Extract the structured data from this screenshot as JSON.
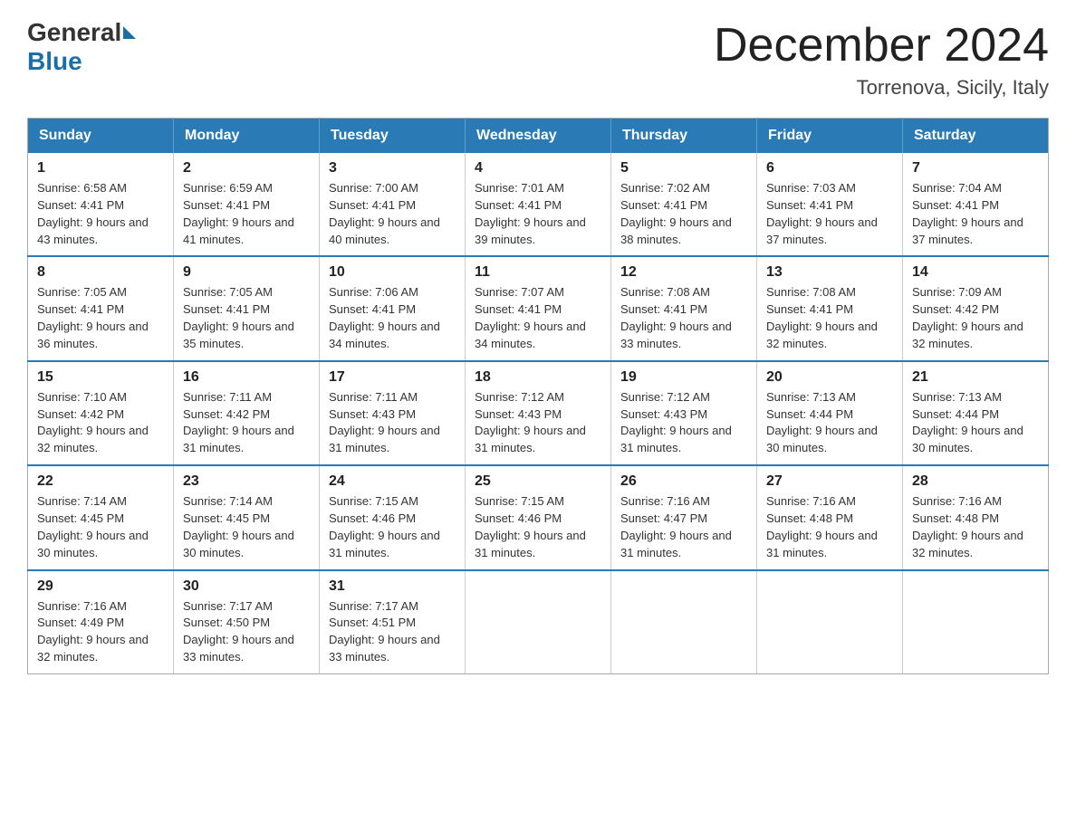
{
  "header": {
    "logo_general": "General",
    "logo_blue": "Blue",
    "month_title": "December 2024",
    "location": "Torrenova, Sicily, Italy"
  },
  "days_of_week": [
    "Sunday",
    "Monday",
    "Tuesday",
    "Wednesday",
    "Thursday",
    "Friday",
    "Saturday"
  ],
  "weeks": [
    [
      {
        "day": "1",
        "sunrise": "6:58 AM",
        "sunset": "4:41 PM",
        "daylight": "9 hours and 43 minutes."
      },
      {
        "day": "2",
        "sunrise": "6:59 AM",
        "sunset": "4:41 PM",
        "daylight": "9 hours and 41 minutes."
      },
      {
        "day": "3",
        "sunrise": "7:00 AM",
        "sunset": "4:41 PM",
        "daylight": "9 hours and 40 minutes."
      },
      {
        "day": "4",
        "sunrise": "7:01 AM",
        "sunset": "4:41 PM",
        "daylight": "9 hours and 39 minutes."
      },
      {
        "day": "5",
        "sunrise": "7:02 AM",
        "sunset": "4:41 PM",
        "daylight": "9 hours and 38 minutes."
      },
      {
        "day": "6",
        "sunrise": "7:03 AM",
        "sunset": "4:41 PM",
        "daylight": "9 hours and 37 minutes."
      },
      {
        "day": "7",
        "sunrise": "7:04 AM",
        "sunset": "4:41 PM",
        "daylight": "9 hours and 37 minutes."
      }
    ],
    [
      {
        "day": "8",
        "sunrise": "7:05 AM",
        "sunset": "4:41 PM",
        "daylight": "9 hours and 36 minutes."
      },
      {
        "day": "9",
        "sunrise": "7:05 AM",
        "sunset": "4:41 PM",
        "daylight": "9 hours and 35 minutes."
      },
      {
        "day": "10",
        "sunrise": "7:06 AM",
        "sunset": "4:41 PM",
        "daylight": "9 hours and 34 minutes."
      },
      {
        "day": "11",
        "sunrise": "7:07 AM",
        "sunset": "4:41 PM",
        "daylight": "9 hours and 34 minutes."
      },
      {
        "day": "12",
        "sunrise": "7:08 AM",
        "sunset": "4:41 PM",
        "daylight": "9 hours and 33 minutes."
      },
      {
        "day": "13",
        "sunrise": "7:08 AM",
        "sunset": "4:41 PM",
        "daylight": "9 hours and 32 minutes."
      },
      {
        "day": "14",
        "sunrise": "7:09 AM",
        "sunset": "4:42 PM",
        "daylight": "9 hours and 32 minutes."
      }
    ],
    [
      {
        "day": "15",
        "sunrise": "7:10 AM",
        "sunset": "4:42 PM",
        "daylight": "9 hours and 32 minutes."
      },
      {
        "day": "16",
        "sunrise": "7:11 AM",
        "sunset": "4:42 PM",
        "daylight": "9 hours and 31 minutes."
      },
      {
        "day": "17",
        "sunrise": "7:11 AM",
        "sunset": "4:43 PM",
        "daylight": "9 hours and 31 minutes."
      },
      {
        "day": "18",
        "sunrise": "7:12 AM",
        "sunset": "4:43 PM",
        "daylight": "9 hours and 31 minutes."
      },
      {
        "day": "19",
        "sunrise": "7:12 AM",
        "sunset": "4:43 PM",
        "daylight": "9 hours and 31 minutes."
      },
      {
        "day": "20",
        "sunrise": "7:13 AM",
        "sunset": "4:44 PM",
        "daylight": "9 hours and 30 minutes."
      },
      {
        "day": "21",
        "sunrise": "7:13 AM",
        "sunset": "4:44 PM",
        "daylight": "9 hours and 30 minutes."
      }
    ],
    [
      {
        "day": "22",
        "sunrise": "7:14 AM",
        "sunset": "4:45 PM",
        "daylight": "9 hours and 30 minutes."
      },
      {
        "day": "23",
        "sunrise": "7:14 AM",
        "sunset": "4:45 PM",
        "daylight": "9 hours and 30 minutes."
      },
      {
        "day": "24",
        "sunrise": "7:15 AM",
        "sunset": "4:46 PM",
        "daylight": "9 hours and 31 minutes."
      },
      {
        "day": "25",
        "sunrise": "7:15 AM",
        "sunset": "4:46 PM",
        "daylight": "9 hours and 31 minutes."
      },
      {
        "day": "26",
        "sunrise": "7:16 AM",
        "sunset": "4:47 PM",
        "daylight": "9 hours and 31 minutes."
      },
      {
        "day": "27",
        "sunrise": "7:16 AM",
        "sunset": "4:48 PM",
        "daylight": "9 hours and 31 minutes."
      },
      {
        "day": "28",
        "sunrise": "7:16 AM",
        "sunset": "4:48 PM",
        "daylight": "9 hours and 32 minutes."
      }
    ],
    [
      {
        "day": "29",
        "sunrise": "7:16 AM",
        "sunset": "4:49 PM",
        "daylight": "9 hours and 32 minutes."
      },
      {
        "day": "30",
        "sunrise": "7:17 AM",
        "sunset": "4:50 PM",
        "daylight": "9 hours and 33 minutes."
      },
      {
        "day": "31",
        "sunrise": "7:17 AM",
        "sunset": "4:51 PM",
        "daylight": "9 hours and 33 minutes."
      },
      null,
      null,
      null,
      null
    ]
  ]
}
